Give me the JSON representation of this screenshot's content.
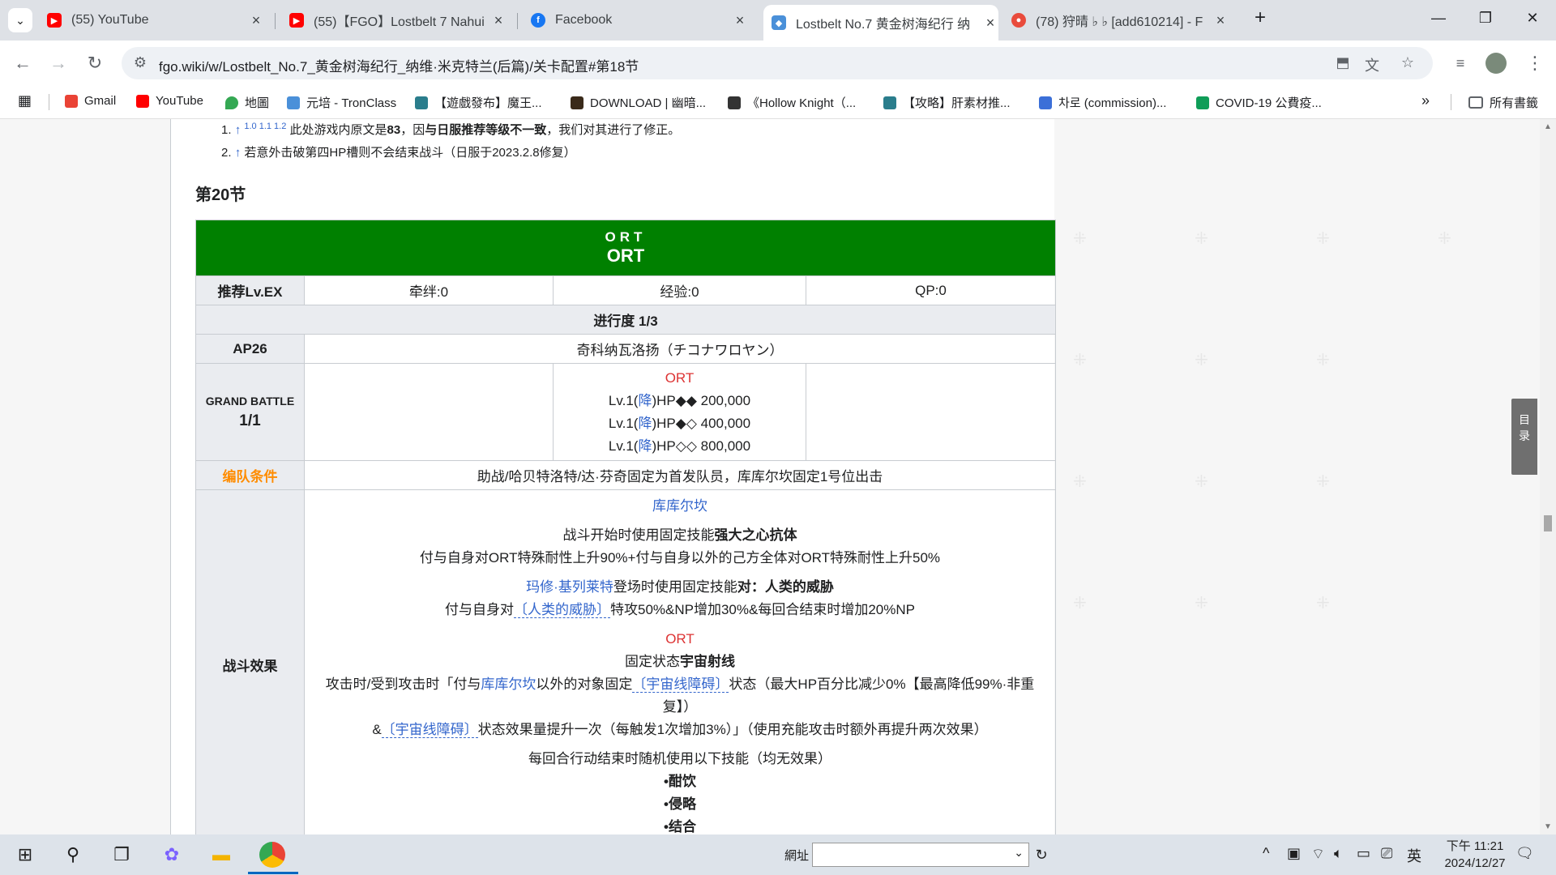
{
  "browser": {
    "tabs": [
      {
        "title": "(55) YouTube",
        "icon": "youtube-icon",
        "active": false
      },
      {
        "title": "(55)【FGO】Lostbelt 7 Nahui",
        "icon": "youtube-icon",
        "active": false
      },
      {
        "title": "Facebook",
        "icon": "facebook-icon",
        "active": false
      },
      {
        "title": "Lostbelt No.7 黄金树海纪行 纳",
        "icon": "wiki-icon",
        "active": true
      },
      {
        "title": "(78) 狩晴 ♭ ♭ [add610214] - F",
        "icon": "site-icon",
        "active": false
      }
    ],
    "url": "fgo.wiki/w/Lostbelt_No.7_黄金树海纪行_纳维·米克特兰(后篇)/关卡配置#第18节",
    "bookmarks": [
      {
        "label": "Gmail",
        "color": "#ea4335"
      },
      {
        "label": "YouTube",
        "color": "#ff0000"
      },
      {
        "label": "地圖",
        "color": "#34a853"
      },
      {
        "label": "元培 - TronClass",
        "color": "#4a90d9"
      },
      {
        "label": "【遊戲發布】魔王...",
        "color": "#2a7d8c"
      },
      {
        "label": "DOWNLOAD | 幽暗...",
        "color": "#3a2a1a"
      },
      {
        "label": "《Hollow Knight（...",
        "color": "#333333"
      },
      {
        "label": "【攻略】肝素材推...",
        "color": "#2a7d8c"
      },
      {
        "label": "차로 (commission)...",
        "color": "#3b6fd8"
      },
      {
        "label": "COVID-19 公費疫...",
        "color": "#0f9d58"
      }
    ],
    "all_bookmarks": "所有書籤"
  },
  "page": {
    "refs": [
      {
        "num": "1.",
        "sups": "1.0 1.1 1.2",
        "text_pre": "此处游戏内原文是",
        "bold1": "83",
        "text_mid": "，因",
        "bold2": "与日服推荐等级不一致",
        "text_post": "，我们对其进行了修正。"
      },
      {
        "num": "2.",
        "text": "若意外击破第四HP槽则不会结束战斗（日服于2023.2.8修复）"
      }
    ],
    "section_title": "第20节",
    "table": {
      "header_line1": "ORT",
      "header_line2": "ORT",
      "rec_label": "推荐Lv.EX",
      "bond": "牵绊:0",
      "exp": "经验:0",
      "qp": "QP:0",
      "progress": "进行度 1/3",
      "ap": "AP26",
      "location": "奇科纳瓦洛扬（チコナワロヤン）",
      "battle_label1": "GRAND BATTLE",
      "battle_label2": "1/1",
      "enemy_name": "ORT",
      "enemy_lines": [
        {
          "pre": "Lv.1(",
          "cls": "降",
          "post": ")HP◆◆ 200,000"
        },
        {
          "pre": "Lv.1(",
          "cls": "降",
          "post": ")HP◆◇ 400,000"
        },
        {
          "pre": "Lv.1(",
          "cls": "降",
          "post": ")HP◇◇ 800,000"
        }
      ],
      "team_label": "编队条件",
      "team_text": "助战/哈贝特洛特/达·芬奇固定为首发队员，库库尔坎固定1号位出击",
      "effect_label": "战斗效果",
      "effects": {
        "kukulkan_name": "库库尔坎",
        "kukulkan_l1_pre": "战斗开始时使用固定技能",
        "kukulkan_l1_bold": "强大之心抗体",
        "kukulkan_l2": "付与自身对ORT特殊耐性上升90%+付与自身以外的己方全体对ORT特殊耐性上升50%",
        "matthew_name": "玛修·基列莱特",
        "matthew_l1_mid": "登场时使用固定技能",
        "matthew_l1_bold": "对：人类的威胁",
        "matthew_l2_pre": "付与自身对",
        "matthew_l2_link": "〔人类的威胁〕",
        "matthew_l2_post": "特攻50%&NP增加30%&每回合结束时增加20%NP",
        "ort_name": "ORT",
        "ort_l1_pre": "固定状态",
        "ort_l1_bold": "宇宙射线",
        "ort_l2_pre": "攻击时/受到攻击时「付与",
        "ort_l2_link1": "库库尔坎",
        "ort_l2_mid": "以外的对象固定",
        "ort_l2_link2": "〔宇宙线障碍〕",
        "ort_l2_post": "状态（最大HP百分比减少0%【最高降低99%·非重",
        "ort_l3": "复】）",
        "ort_l4_pre": "&",
        "ort_l4_link": "〔宇宙线障碍〕",
        "ort_l4_post": "状态效果量提升一次（每触发1次增加3%）」（使用充能攻击时额外再提升两次效果）",
        "random_intro": "每回合行动结束时随机使用以下技能（均无效果）",
        "random_skills": [
          "•酣饮",
          "•侵略",
          "•结合"
        ]
      }
    },
    "toc_label": "目录"
  },
  "taskbar": {
    "address_label": "網址",
    "ime": "英",
    "time": "下午 11:21",
    "date": "2024/12/27"
  }
}
